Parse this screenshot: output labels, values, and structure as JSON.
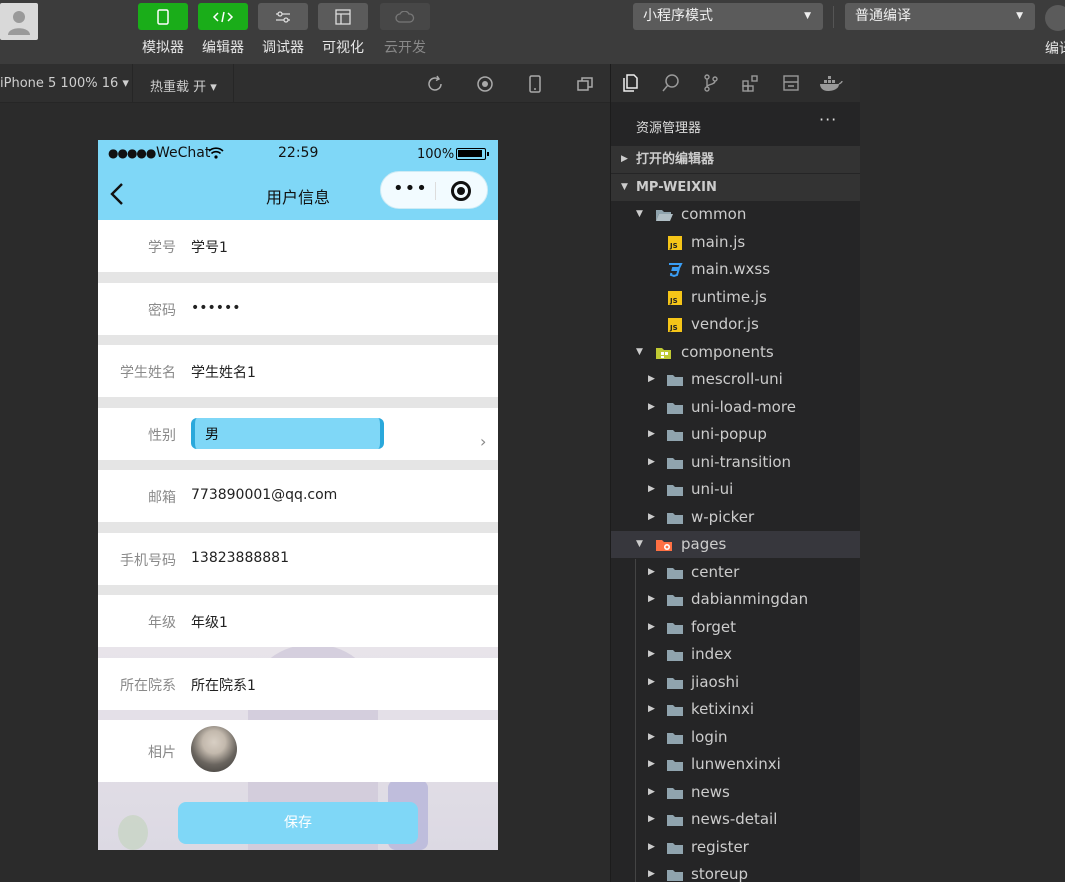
{
  "toolbar": {
    "tools": [
      {
        "label": "模拟器"
      },
      {
        "label": "编辑器"
      },
      {
        "label": "调试器"
      },
      {
        "label": "可视化"
      },
      {
        "label": "云开发"
      }
    ],
    "mode_select": "小程序模式",
    "compile_select": "普通编译",
    "right_label": "编译"
  },
  "subbar": {
    "device": "iPhone 5 100% 16 ▾",
    "hot_reload": "热重载 开 ▾"
  },
  "phone": {
    "status": {
      "dots": "●●●●●",
      "carrier": "WeChat",
      "time": "22:59",
      "battery": "100%"
    },
    "nav_title": "用户信息",
    "capsule_more": "•••",
    "rows": [
      {
        "key": "学号",
        "value": "学号1"
      },
      {
        "key": "密码",
        "value": "••••••"
      },
      {
        "key": "学生姓名",
        "value": "学生姓名1"
      },
      {
        "key": "性别",
        "value": "男"
      },
      {
        "key": "邮箱",
        "value": "773890001@qq.com"
      },
      {
        "key": "手机号码",
        "value": "13823888881"
      },
      {
        "key": "年级",
        "value": "年级1"
      },
      {
        "key": "所在院系",
        "value": "所在院系1"
      },
      {
        "key": "相片",
        "value": ""
      }
    ],
    "save_label": "保存",
    "chevron": "›"
  },
  "explorer": {
    "title": "资源管理器",
    "more": "···",
    "tree": [
      {
        "label": "打开的编辑器",
        "type": "section",
        "arrow": "▶"
      },
      {
        "label": "MP-WEIXIN",
        "type": "section",
        "arrow": "▼"
      },
      {
        "label": "common",
        "type": "folder-open",
        "arrow": "▼"
      },
      {
        "label": "main.js",
        "type": "js"
      },
      {
        "label": "main.wxss",
        "type": "css"
      },
      {
        "label": "runtime.js",
        "type": "js"
      },
      {
        "label": "vendor.js",
        "type": "js"
      },
      {
        "label": "components",
        "type": "folder-open-green",
        "arrow": "▼"
      },
      {
        "label": "mescroll-uni",
        "type": "folder",
        "arrow": "▶"
      },
      {
        "label": "uni-load-more",
        "type": "folder",
        "arrow": "▶"
      },
      {
        "label": "uni-popup",
        "type": "folder",
        "arrow": "▶"
      },
      {
        "label": "uni-transition",
        "type": "folder",
        "arrow": "▶"
      },
      {
        "label": "uni-ui",
        "type": "folder",
        "arrow": "▶"
      },
      {
        "label": "w-picker",
        "type": "folder",
        "arrow": "▶"
      },
      {
        "label": "pages",
        "type": "folder-open-orange",
        "arrow": "▼"
      },
      {
        "label": "center",
        "type": "folder",
        "arrow": "▶"
      },
      {
        "label": "dabianmingdan",
        "type": "folder",
        "arrow": "▶"
      },
      {
        "label": "forget",
        "type": "folder",
        "arrow": "▶"
      },
      {
        "label": "index",
        "type": "folder",
        "arrow": "▶"
      },
      {
        "label": "jiaoshi",
        "type": "folder",
        "arrow": "▶"
      },
      {
        "label": "ketixinxi",
        "type": "folder",
        "arrow": "▶"
      },
      {
        "label": "login",
        "type": "folder",
        "arrow": "▶"
      },
      {
        "label": "lunwenxinxi",
        "type": "folder",
        "arrow": "▶"
      },
      {
        "label": "news",
        "type": "folder",
        "arrow": "▶"
      },
      {
        "label": "news-detail",
        "type": "folder",
        "arrow": "▶"
      },
      {
        "label": "register",
        "type": "folder",
        "arrow": "▶"
      },
      {
        "label": "storeup",
        "type": "folder",
        "arrow": "▶"
      }
    ]
  }
}
